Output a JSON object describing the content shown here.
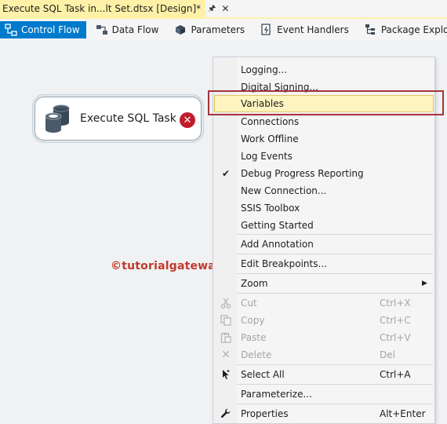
{
  "document_tab": {
    "title": "Execute SQL Task in...lt Set.dtsx [Design]*",
    "pin_icon": "pin-icon",
    "close_icon": "close-icon"
  },
  "designer_tabs": [
    {
      "label": "Control Flow",
      "icon": "control-flow-icon",
      "active": true
    },
    {
      "label": "Data Flow",
      "icon": "data-flow-icon",
      "active": false
    },
    {
      "label": "Parameters",
      "icon": "parameters-icon",
      "active": false
    },
    {
      "label": "Event Handlers",
      "icon": "event-handlers-icon",
      "active": false
    },
    {
      "label": "Package Explorer",
      "icon": "package-explorer-icon",
      "active": false
    }
  ],
  "canvas": {
    "task": {
      "label": "Execute SQL Task",
      "icon": "database-icon",
      "status_icon": "error-icon"
    },
    "watermark": "©tutorialgateway.org"
  },
  "context_menu": {
    "items": [
      {
        "label": "Logging...",
        "shortcut": "",
        "enabled": true
      },
      {
        "label": "Digital Signing...",
        "shortcut": "",
        "enabled": true
      },
      {
        "label": "Variables",
        "shortcut": "",
        "enabled": true,
        "highlighted": true
      },
      {
        "label": "Connections",
        "shortcut": "",
        "enabled": true
      },
      {
        "label": "Work Offline",
        "shortcut": "",
        "enabled": true
      },
      {
        "label": "Log Events",
        "shortcut": "",
        "enabled": true
      },
      {
        "label": "Debug Progress Reporting",
        "shortcut": "",
        "enabled": true,
        "checked": true
      },
      {
        "label": "New Connection...",
        "shortcut": "",
        "enabled": true
      },
      {
        "label": "SSIS Toolbox",
        "shortcut": "",
        "enabled": true
      },
      {
        "label": "Getting Started",
        "shortcut": "",
        "enabled": true
      },
      {
        "label": "Add Annotation",
        "shortcut": "",
        "enabled": true
      },
      {
        "label": "Edit Breakpoints...",
        "shortcut": "",
        "enabled": true
      },
      {
        "label": "Zoom",
        "shortcut": "",
        "enabled": true,
        "submenu": true
      },
      {
        "label": "Cut",
        "shortcut": "Ctrl+X",
        "enabled": false,
        "icon": "cut-icon"
      },
      {
        "label": "Copy",
        "shortcut": "Ctrl+C",
        "enabled": false,
        "icon": "copy-icon"
      },
      {
        "label": "Paste",
        "shortcut": "Ctrl+V",
        "enabled": false,
        "icon": "paste-icon"
      },
      {
        "label": "Delete",
        "shortcut": "Del",
        "enabled": false,
        "icon": "delete-icon"
      },
      {
        "label": "Select All",
        "shortcut": "Ctrl+A",
        "enabled": true,
        "icon": "select-all-icon"
      },
      {
        "label": "Parameterize...",
        "shortcut": "",
        "enabled": true
      },
      {
        "label": "Properties",
        "shortcut": "Alt+Enter",
        "enabled": true,
        "icon": "wrench-icon"
      }
    ]
  },
  "colors": {
    "active_tab": "#007acc",
    "document_tab": "#fff2a8",
    "highlight_frame": "#a4343a",
    "error": "#c01d2b",
    "watermark": "#c0392b"
  }
}
